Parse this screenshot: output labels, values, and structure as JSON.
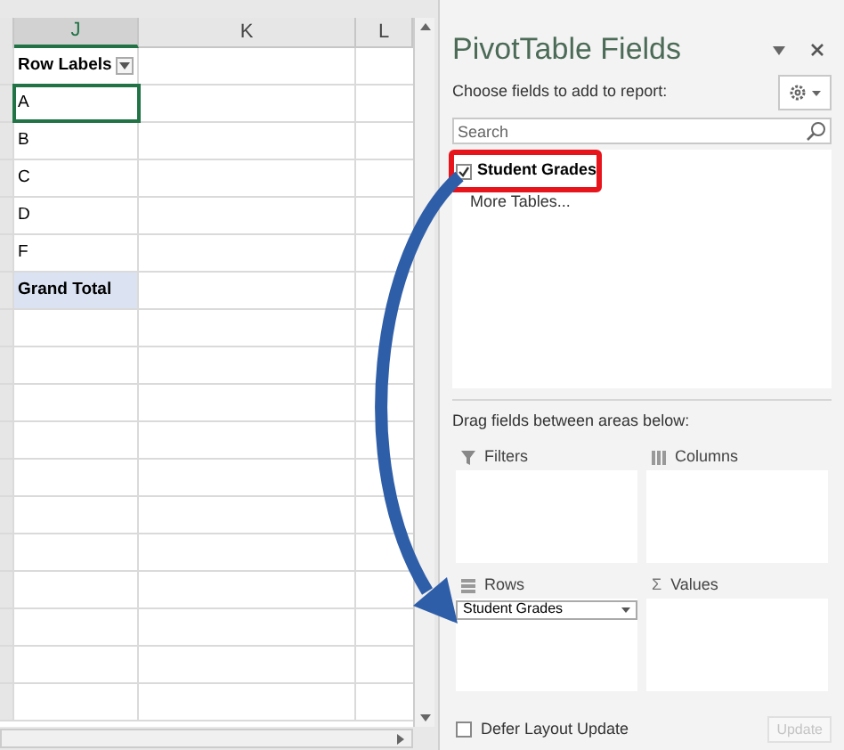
{
  "sheet": {
    "columns": [
      {
        "label": "J",
        "selected": true
      },
      {
        "label": "K",
        "selected": false
      },
      {
        "label": "L",
        "selected": false
      }
    ],
    "cells": [
      {
        "text": "Row Labels",
        "kind": "header",
        "selected": false
      },
      {
        "text": "A",
        "kind": "item",
        "selected": true
      },
      {
        "text": "B",
        "kind": "item",
        "selected": false
      },
      {
        "text": "C",
        "kind": "item",
        "selected": false
      },
      {
        "text": "D",
        "kind": "item",
        "selected": false
      },
      {
        "text": "F",
        "kind": "item",
        "selected": false
      },
      {
        "text": "Grand Total",
        "kind": "total",
        "selected": false
      }
    ]
  },
  "panel": {
    "title": "PivotTable Fields",
    "instruction": "Choose fields to add to report:",
    "search": {
      "placeholder": "Search"
    },
    "fields": [
      {
        "label": "Student Grades",
        "checked": true,
        "highlighted": true
      }
    ],
    "more_tables": "More Tables...",
    "areas_instruction": "Drag fields between areas below:",
    "areas": [
      {
        "label": "Filters",
        "kind": "filters"
      },
      {
        "label": "Columns",
        "kind": "columns"
      },
      {
        "label": "Rows",
        "kind": "rows",
        "fields": [
          "Student Grades"
        ]
      },
      {
        "label": "Values",
        "kind": "values",
        "symbol": "Σ"
      }
    ],
    "defer": {
      "label": "Defer Layout Update",
      "checked": false
    },
    "update_button": {
      "label": "Update",
      "disabled": true
    }
  }
}
